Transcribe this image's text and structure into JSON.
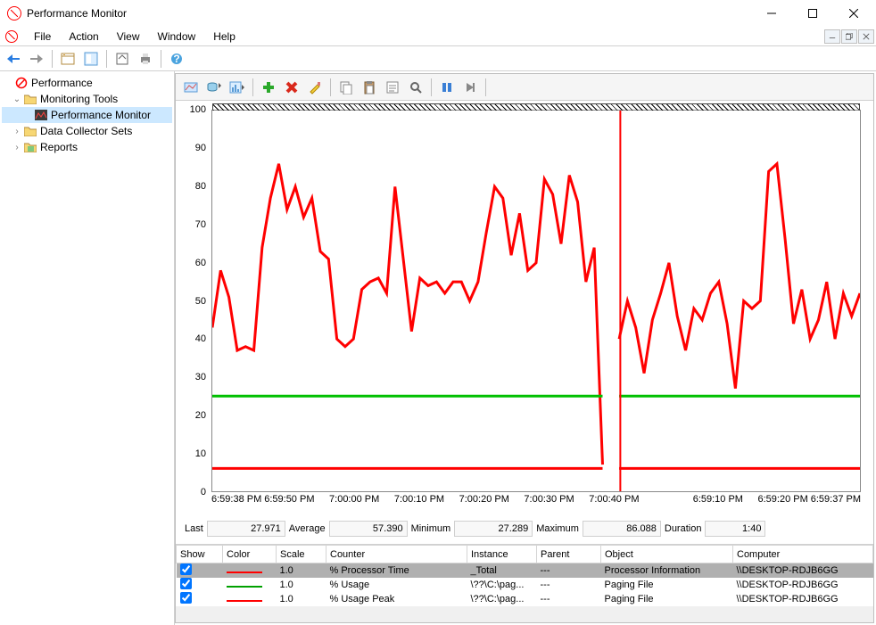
{
  "window": {
    "title": "Performance Monitor"
  },
  "menus": {
    "file": "File",
    "action": "Action",
    "view": "View",
    "window": "Window",
    "help": "Help"
  },
  "tree": {
    "root": "Performance",
    "monitoring_tools": "Monitoring Tools",
    "perfmon": "Performance Monitor",
    "dcs": "Data Collector Sets",
    "reports": "Reports"
  },
  "stats": {
    "last_label": "Last",
    "last": "27.971",
    "avg_label": "Average",
    "avg": "57.390",
    "min_label": "Minimum",
    "min": "27.289",
    "max_label": "Maximum",
    "max": "86.088",
    "dur_label": "Duration",
    "dur": "1:40"
  },
  "table": {
    "headers": {
      "show": "Show",
      "color": "Color",
      "scale": "Scale",
      "counter": "Counter",
      "instance": "Instance",
      "parent": "Parent",
      "object": "Object",
      "computer": "Computer"
    },
    "rows": [
      {
        "show": true,
        "color": "#ff0000",
        "scale": "1.0",
        "counter": "% Processor Time",
        "instance": "_Total",
        "parent": "---",
        "object": "Processor Information",
        "computer": "\\\\DESKTOP-RDJB6GG",
        "selected": true
      },
      {
        "show": true,
        "color": "#00a000",
        "scale": "1.0",
        "counter": "% Usage",
        "instance": "\\??\\C:\\pag...",
        "parent": "---",
        "object": "Paging File",
        "computer": "\\\\DESKTOP-RDJB6GG",
        "selected": false
      },
      {
        "show": true,
        "color": "#ff0000",
        "scale": "1.0",
        "counter": "% Usage Peak",
        "instance": "\\??\\C:\\pag...",
        "parent": "---",
        "object": "Paging File",
        "computer": "\\\\DESKTOP-RDJB6GG",
        "selected": false
      }
    ]
  },
  "chart_data": {
    "type": "line",
    "ylabel": "",
    "xlabel": "",
    "ylim": [
      0,
      100
    ],
    "y_ticks": [
      0,
      10,
      20,
      30,
      40,
      50,
      60,
      70,
      80,
      90,
      100
    ],
    "x_ticks": [
      "6:59:38 PM",
      "6:59:50 PM",
      "7:00:00 PM",
      "7:00:10 PM",
      "7:00:20 PM",
      "7:00:30 PM",
      "7:00:40 PM",
      "6:59:10 PM",
      "6:59:20 PM",
      "6:59:37 PM"
    ],
    "x_tick_positions": [
      0.0,
      0.12,
      0.22,
      0.32,
      0.42,
      0.52,
      0.62,
      0.78,
      0.88,
      1.0
    ],
    "cursor_position": 0.63,
    "series": [
      {
        "name": "% Processor Time",
        "color": "#ff0000",
        "values": [
          43,
          58,
          51,
          37,
          38,
          37,
          64,
          77,
          86,
          74,
          80,
          72,
          77,
          63,
          61,
          40,
          38,
          40,
          53,
          55,
          56,
          52,
          80,
          61,
          42,
          56,
          54,
          55,
          52,
          55,
          55,
          50,
          55,
          68,
          80,
          77,
          62,
          73,
          58,
          60,
          82,
          78,
          65,
          83,
          76,
          55,
          64,
          7,
          null,
          40,
          50,
          43,
          31,
          45,
          52,
          60,
          46,
          37,
          48,
          45,
          52,
          55,
          44,
          27,
          50,
          48,
          50,
          84,
          86,
          66,
          44,
          53,
          40,
          45,
          55,
          40,
          52,
          46,
          52
        ]
      },
      {
        "name": "% Usage",
        "color": "#00c000",
        "values": [
          25,
          25,
          25,
          25,
          25,
          25,
          25,
          25,
          25,
          25,
          25,
          25,
          25,
          25,
          25,
          25,
          25,
          25,
          25,
          25,
          25,
          25,
          25,
          25,
          25,
          25,
          25,
          25,
          25,
          25,
          25,
          25,
          25,
          25,
          25,
          25,
          25,
          25,
          25,
          25,
          25,
          25,
          25,
          25,
          25,
          25,
          25,
          25,
          null,
          25,
          25,
          25,
          25,
          25,
          25,
          25,
          25,
          25,
          25,
          25,
          25,
          25,
          25,
          25,
          25,
          25,
          25,
          25,
          25,
          25,
          25,
          25,
          25,
          25,
          25,
          25,
          25,
          25,
          25
        ]
      },
      {
        "name": "% Usage Peak",
        "color": "#ff0000",
        "values": [
          6,
          6,
          6,
          6,
          6,
          6,
          6,
          6,
          6,
          6,
          6,
          6,
          6,
          6,
          6,
          6,
          6,
          6,
          6,
          6,
          6,
          6,
          6,
          6,
          6,
          6,
          6,
          6,
          6,
          6,
          6,
          6,
          6,
          6,
          6,
          6,
          6,
          6,
          6,
          6,
          6,
          6,
          6,
          6,
          6,
          6,
          6,
          6,
          null,
          6,
          6,
          6,
          6,
          6,
          6,
          6,
          6,
          6,
          6,
          6,
          6,
          6,
          6,
          6,
          6,
          6,
          6,
          6,
          6,
          6,
          6,
          6,
          6,
          6,
          6,
          6,
          6,
          6,
          6
        ]
      }
    ]
  }
}
